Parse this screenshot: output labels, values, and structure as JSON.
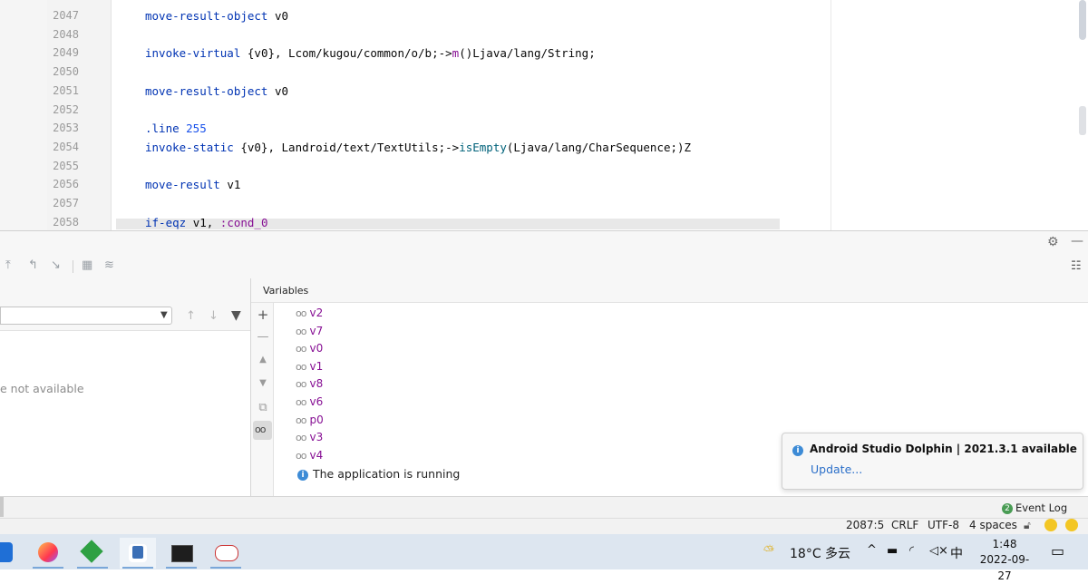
{
  "editor": {
    "lines": [
      {
        "num": "2047",
        "tokens": [
          {
            "t": "move-result-object ",
            "c": "kw"
          },
          {
            "t": "v0",
            "c": ""
          }
        ]
      },
      {
        "num": "2048",
        "tokens": []
      },
      {
        "num": "2049",
        "tokens": [
          {
            "t": "invoke-virtual ",
            "c": "kw"
          },
          {
            "t": "{v0}, Lcom/kugou/common/o/b;->",
            "c": ""
          },
          {
            "t": "m",
            "c": "pu"
          },
          {
            "t": "()Ljava/lang/String;",
            "c": ""
          }
        ]
      },
      {
        "num": "2050",
        "tokens": []
      },
      {
        "num": "2051",
        "tokens": [
          {
            "t": "move-result-object ",
            "c": "kw"
          },
          {
            "t": "v0",
            "c": ""
          }
        ]
      },
      {
        "num": "2052",
        "tokens": []
      },
      {
        "num": "2053",
        "tokens": [
          {
            "t": ".line ",
            "c": "kw"
          },
          {
            "t": "255",
            "c": "num"
          }
        ]
      },
      {
        "num": "2054",
        "tokens": [
          {
            "t": "invoke-static ",
            "c": "kw"
          },
          {
            "t": "{v0}, Landroid/text/TextUtils;->",
            "c": ""
          },
          {
            "t": "isEmpty",
            "c": "fn"
          },
          {
            "t": "(Ljava/lang/CharSequence;)Z",
            "c": ""
          }
        ]
      },
      {
        "num": "2055",
        "tokens": []
      },
      {
        "num": "2056",
        "tokens": [
          {
            "t": "move-result ",
            "c": "kw"
          },
          {
            "t": "v1",
            "c": ""
          }
        ]
      },
      {
        "num": "2057",
        "tokens": []
      },
      {
        "num": "2058",
        "tokens": [
          {
            "t": "if-eqz ",
            "c": "kw"
          },
          {
            "t": "v1, ",
            "c": ""
          },
          {
            "t": ":cond_0",
            "c": "pu"
          }
        ]
      }
    ]
  },
  "frames": {
    "message": "e not available"
  },
  "variables": {
    "title": "Variables",
    "items": [
      "v2",
      "v7",
      "v0",
      "v1",
      "v8",
      "v6",
      "p0",
      "v3",
      "v4"
    ],
    "running_message": "The application is running"
  },
  "notification": {
    "title": "Android Studio Dolphin | 2021.3.1 available",
    "link": "Update..."
  },
  "event_log": {
    "badge": "2",
    "label": "Event Log"
  },
  "status_bar": {
    "position": "2087:5",
    "line_sep": "CRLF",
    "encoding": "UTF-8",
    "indent": "4 spaces"
  },
  "taskbar": {
    "weather": "18°C 多云",
    "ime": "中",
    "time": "1:48",
    "date": "2022-09-27"
  },
  "colors": {
    "keyword": "#0033b3",
    "purple": "#871094",
    "accent_link": "#2b6fc9",
    "taskbar": "#dde6f0"
  }
}
